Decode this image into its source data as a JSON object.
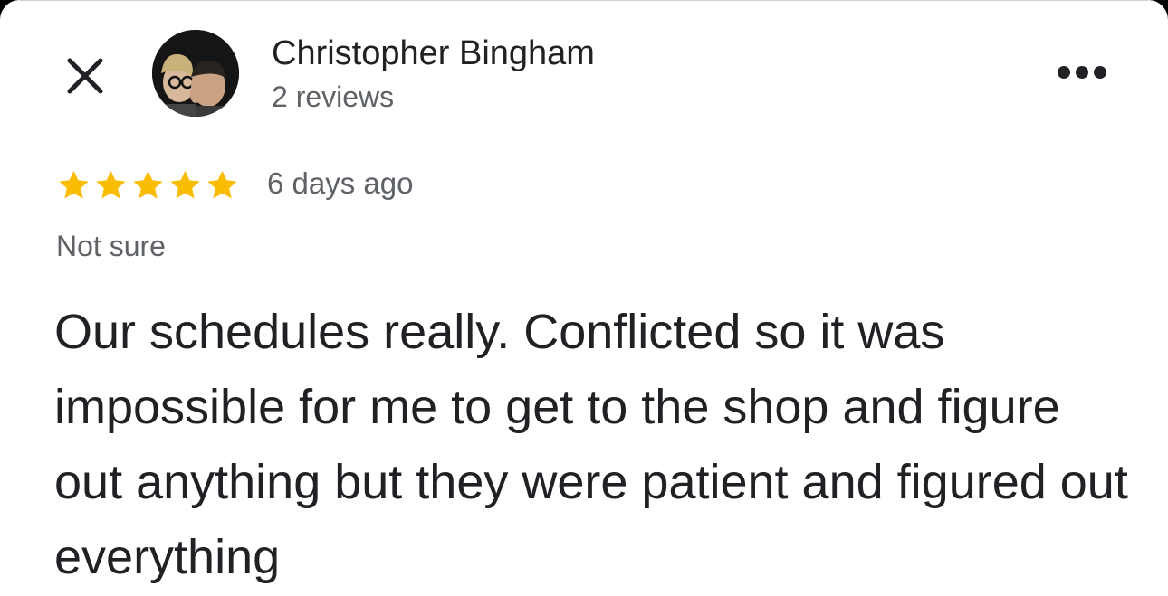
{
  "author": {
    "name": "Christopher Bingham",
    "reviews_count": "2 reviews",
    "avatar_icon": "user-avatar-photo"
  },
  "review": {
    "rating": 5,
    "rating_max": 5,
    "time_ago": "6 days ago",
    "tag": "Not sure",
    "text": "Our schedules really. Conflicted so it was impossible for me to get to the shop and figure out anything but they were patient and figured out everything"
  },
  "icons": {
    "close": "close-icon",
    "more": "more-horizontal-icon",
    "star": "star-icon"
  },
  "colors": {
    "star_filled": "#FBBC04",
    "text_primary": "#202124",
    "text_secondary": "#5f6368",
    "background": "#ffffff"
  }
}
